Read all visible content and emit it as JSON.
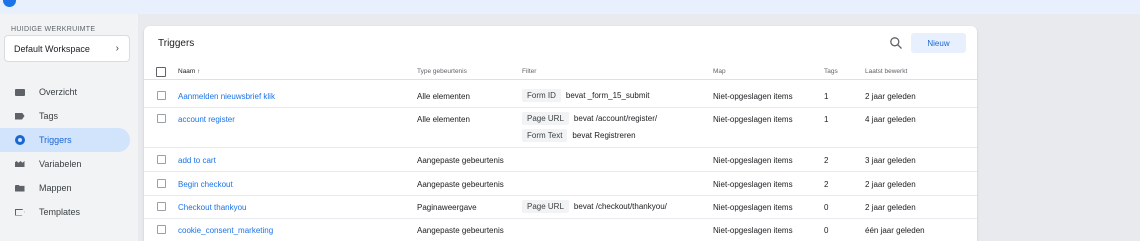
{
  "sidebar": {
    "workspace_label": "HUIDIGE WERKRUIMTE",
    "workspace_name": "Default Workspace",
    "items": [
      {
        "label": "Overzicht",
        "icon": "briefcase-icon"
      },
      {
        "label": "Tags",
        "icon": "tag-icon"
      },
      {
        "label": "Triggers",
        "icon": "trigger-icon",
        "active": true
      },
      {
        "label": "Variabelen",
        "icon": "variables-icon"
      },
      {
        "label": "Mappen",
        "icon": "folder-icon"
      },
      {
        "label": "Templates",
        "icon": "template-icon"
      }
    ]
  },
  "main": {
    "title": "Triggers",
    "new_button": "Nieuw",
    "columns": {
      "name": "Naam ↑",
      "type": "Type gebeurtenis",
      "filter": "Filter",
      "folder": "Map",
      "tags": "Tags",
      "edited": "Laatst bewerkt"
    },
    "rows": [
      {
        "name": "Aanmelden nieuwsbrief klik",
        "type": "Alle elementen",
        "filters": [
          {
            "key": "Form ID",
            "op": "bevat _form_15_submit"
          }
        ],
        "folder": "Niet-opgeslagen items",
        "tags": "1",
        "edited": "2 jaar geleden"
      },
      {
        "name": "account register",
        "type": "Alle elementen",
        "filters": [
          {
            "key": "Page URL",
            "op": "bevat /account/register/"
          },
          {
            "key": "Form Text",
            "op": "bevat Registreren"
          }
        ],
        "folder": "Niet-opgeslagen items",
        "tags": "1",
        "edited": "4 jaar geleden"
      },
      {
        "name": "add to cart",
        "type": "Aangepaste gebeurtenis",
        "filters": [],
        "folder": "Niet-opgeslagen items",
        "tags": "2",
        "edited": "3 jaar geleden"
      },
      {
        "name": "Begin checkout",
        "type": "Aangepaste gebeurtenis",
        "filters": [],
        "folder": "Niet-opgeslagen items",
        "tags": "2",
        "edited": "2 jaar geleden"
      },
      {
        "name": "Checkout thankyou",
        "type": "Paginaweergave",
        "filters": [
          {
            "key": "Page URL",
            "op": "bevat /checkout/thankyou/"
          }
        ],
        "folder": "Niet-opgeslagen items",
        "tags": "0",
        "edited": "2 jaar geleden"
      },
      {
        "name": "cookie_consent_marketing",
        "type": "Aangepaste gebeurtenis",
        "filters": [],
        "folder": "Niet-opgeslagen items",
        "tags": "0",
        "edited": "één jaar geleden"
      }
    ]
  },
  "colors": {
    "accent": "#1a73e8",
    "active_bg": "#d2e3fc",
    "button_bg": "#e8f0fe"
  }
}
